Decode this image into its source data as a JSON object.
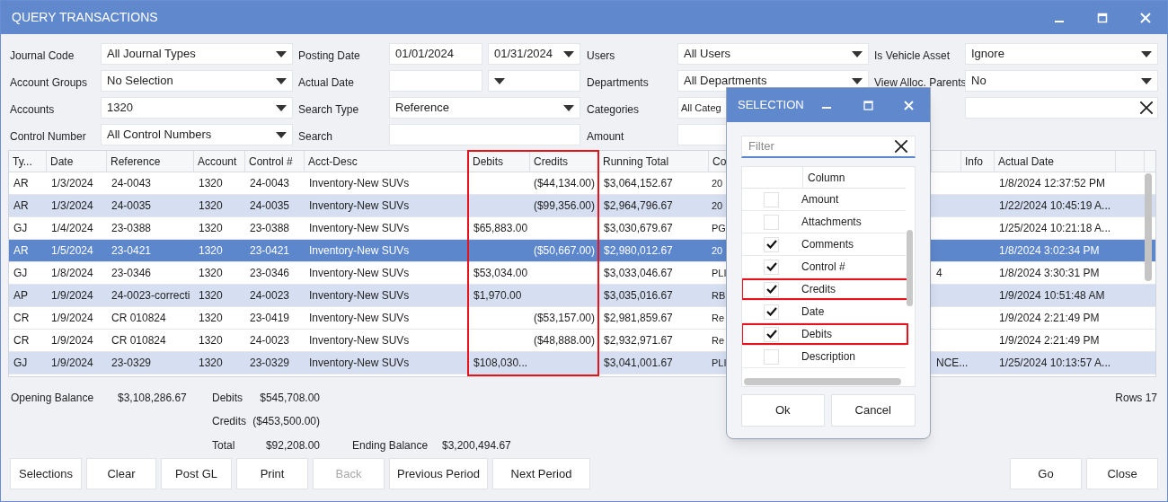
{
  "window": {
    "title": "QUERY TRANSACTIONS"
  },
  "filters": [
    [
      {
        "label": "Journal Code",
        "kind": "select",
        "value": "All Journal Types",
        "caret": true
      },
      {
        "label": "Posting Date",
        "kind": "date_range",
        "from": "01/01/2024",
        "to": "01/31/2024"
      },
      {
        "label": "Users",
        "kind": "select",
        "value": "All Users",
        "caret": true
      },
      {
        "label": "Is Vehicle Asset",
        "kind": "select",
        "value": "Ignore",
        "caret": true
      }
    ],
    [
      {
        "label": "Account Groups",
        "kind": "select",
        "value": "No Selection",
        "caret": true
      },
      {
        "label": "Actual Date",
        "kind": "date_range"
      },
      {
        "label": "Departments",
        "kind": "select",
        "value": "All Departments",
        "caret": true
      },
      {
        "label": "View Alloc. Parents",
        "kind": "select",
        "value": "No",
        "caret": true
      }
    ],
    [
      {
        "label": "Accounts",
        "kind": "select",
        "value": "1320",
        "caret": true
      },
      {
        "label": "Search Type",
        "kind": "select",
        "value": "Reference",
        "caret": true
      },
      {
        "label": "Categories",
        "kind": "select",
        "value": "All Categ",
        "caret": false
      },
      {
        "kind": "clearable"
      }
    ],
    [
      {
        "label": "Control Number",
        "kind": "select",
        "value": "All Control Numbers",
        "caret": true
      },
      {
        "label": "Search",
        "kind": "text"
      },
      {
        "label": "Amount",
        "kind": "text"
      }
    ]
  ],
  "table": {
    "columns": [
      {
        "label": "Ty...",
        "highlighted": false
      },
      {
        "label": "Date",
        "highlighted": false
      },
      {
        "label": "Reference",
        "highlighted": false
      },
      {
        "label": "Account",
        "highlighted": false
      },
      {
        "label": "Control #",
        "highlighted": false
      },
      {
        "label": "Acct-Desc",
        "highlighted": false
      },
      {
        "label": "Debits",
        "highlighted": true
      },
      {
        "label": "Credits",
        "highlighted": true
      },
      {
        "label": "Running Total",
        "highlighted": false
      },
      {
        "label": "Co",
        "highlighted": false
      },
      {
        "highlighted": false
      },
      {
        "label": "Info",
        "highlighted": false
      },
      {
        "label": "Actual Date",
        "highlighted": false
      },
      {
        "highlighted": false
      }
    ],
    "rows": [
      {
        "selected": false,
        "striped": false,
        "cells": [
          "AR",
          "1/3/2024",
          "24-0043",
          "1320",
          "24-0043",
          "Inventory-New SUVs",
          "",
          "($44,134.00)",
          "$3,064,152.67",
          "20",
          "",
          "",
          "1/8/2024 12:37:52 PM",
          ""
        ]
      },
      {
        "selected": false,
        "striped": true,
        "cells": [
          "AR",
          "1/3/2024",
          "24-0035",
          "1320",
          "24-0035",
          "Inventory-New SUVs",
          "",
          "($99,356.00)",
          "$2,964,796.67",
          "20",
          "",
          "",
          "1/22/2024 10:45:19 A...",
          ""
        ]
      },
      {
        "selected": false,
        "striped": false,
        "cells": [
          "GJ",
          "1/4/2024",
          "23-0388",
          "1320",
          "23-0388",
          "Inventory-New SUVs",
          "$65,883.00",
          "",
          "$3,030,679.67",
          "PG",
          "",
          "",
          "1/25/2024 10:21:18 A...",
          ""
        ]
      },
      {
        "selected": true,
        "striped": false,
        "cells": [
          "AR",
          "1/5/2024",
          "23-0421",
          "1320",
          "23-0421",
          "Inventory-New SUVs",
          "",
          "($50,667.00)",
          "$2,980,012.67",
          "20",
          "",
          "",
          "1/8/2024 3:02:34 PM",
          ""
        ]
      },
      {
        "selected": false,
        "striped": false,
        "cells": [
          "GJ",
          "1/8/2024",
          "23-0346",
          "1320",
          "23-0346",
          "Inventory-New SUVs",
          "$53,034.00",
          "",
          "$3,033,046.67",
          "PLI",
          "4",
          "",
          "1/8/2024 3:30:31 PM",
          ""
        ]
      },
      {
        "selected": false,
        "striped": true,
        "cells": [
          "AP",
          "1/9/2024",
          "24-0023-correcti",
          "1320",
          "24-0023",
          "Inventory-New SUVs",
          "$1,970.00",
          "",
          "$3,035,016.67",
          "RB",
          "",
          "",
          "1/9/2024 10:51:48 AM",
          ""
        ]
      },
      {
        "selected": false,
        "striped": false,
        "cells": [
          "CR",
          "1/9/2024",
          "CR 010824",
          "1320",
          "23-0419",
          "Inventory-New SUVs",
          "",
          "($53,157.00)",
          "$2,981,859.67",
          "Re",
          "",
          "",
          "1/9/2024 2:21:49 PM",
          ""
        ]
      },
      {
        "selected": false,
        "striped": false,
        "cells": [
          "CR",
          "1/9/2024",
          "CR 010824",
          "1320",
          "24-0023",
          "Inventory-New SUVs",
          "",
          "($48,888.00)",
          "$2,932,971.67",
          "Re",
          "",
          "",
          "1/9/2024 2:21:49 PM",
          ""
        ]
      },
      {
        "selected": false,
        "striped": true,
        "cells": [
          "GJ",
          "1/9/2024",
          "23-0329",
          "1320",
          "23-0329",
          "Inventory-New SUVs",
          "$108,030...",
          "",
          "$3,041,001.67",
          "PLI",
          "NCE...",
          "",
          "1/25/2024 10:13:57 A...",
          ""
        ]
      }
    ]
  },
  "summary": {
    "opening_balance_label": "Opening Balance",
    "opening_balance": "$3,108,286.67",
    "debits_label": "Debits",
    "debits": "$545,708.00",
    "credits_label": "Credits",
    "credits": "($453,500.00)",
    "total_label": "Total",
    "total": "$92,208.00",
    "ending_balance_label": "Ending Balance",
    "ending_balance": "$3,200,494.67",
    "rows": "Rows 17"
  },
  "buttons": [
    {
      "label": "Selections",
      "disabled": false
    },
    {
      "label": "Clear",
      "disabled": false
    },
    {
      "label": "Post GL",
      "disabled": false
    },
    {
      "label": "Print",
      "disabled": false
    },
    {
      "label": "Back",
      "disabled": true
    },
    {
      "label": "Previous Period",
      "disabled": false
    },
    {
      "label": "Next Period",
      "disabled": false
    }
  ],
  "right_buttons": [
    {
      "label": "Go",
      "disabled": false
    },
    {
      "label": "Close",
      "disabled": false
    }
  ],
  "dialog": {
    "title": "SELECTION",
    "filter_placeholder": "Filter",
    "column_header": "Column",
    "items": [
      {
        "label": "Amount",
        "checked": false,
        "highlighted": false
      },
      {
        "label": "Attachments",
        "checked": false,
        "highlighted": false
      },
      {
        "label": "Comments",
        "checked": true,
        "highlighted": false
      },
      {
        "label": "Control #",
        "checked": true,
        "highlighted": false
      },
      {
        "label": "Credits",
        "checked": true,
        "highlighted": true
      },
      {
        "label": "Date",
        "checked": true,
        "highlighted": false
      },
      {
        "label": "Debits",
        "checked": true,
        "highlighted": true
      },
      {
        "label": "Description",
        "checked": false,
        "highlighted": false
      }
    ],
    "buttons": [
      "Ok",
      "Cancel"
    ]
  }
}
